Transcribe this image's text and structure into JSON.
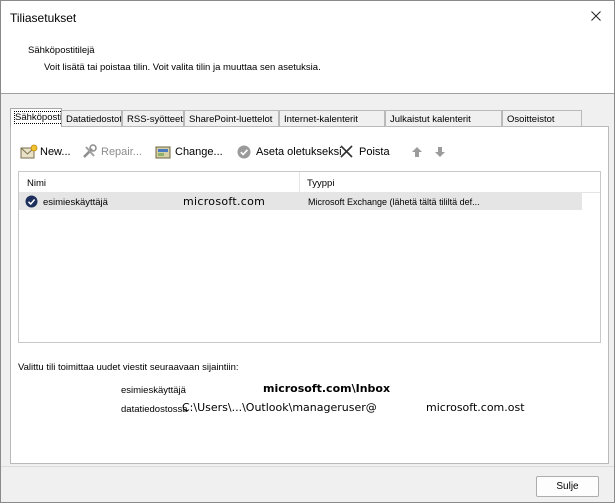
{
  "window": {
    "title": "Tiliasetukset",
    "close_icon": "close-icon"
  },
  "header": {
    "title": "Sähköpostitilejä",
    "description": "Voit lisätä tai poistaa tilin. Voit valita tilin ja muuttaa sen asetuksia."
  },
  "tabs": [
    {
      "label": "Sähköposti",
      "active": true
    },
    {
      "label": "Datatiedostot",
      "active": false
    },
    {
      "label": "RSS-syötteet",
      "active": false
    },
    {
      "label": "SharePoint-luettelot",
      "active": false
    },
    {
      "label": "Internet-kalenterit",
      "active": false
    },
    {
      "label": "Julkaistut kalenterit",
      "active": false
    },
    {
      "label": "Osoitteistot",
      "active": false
    }
  ],
  "toolbar": {
    "new_label": "New...",
    "repair_label": "Repair...",
    "change_label": "Change...",
    "set_default_label": "Aseta oletukseksi",
    "remove_label": "Poista",
    "move_up_icon": "arrow-up-icon",
    "move_down_icon": "arrow-down-icon"
  },
  "accounts_table": {
    "columns": [
      "Nimi",
      "Tyyppi"
    ],
    "rows": [
      {
        "name_user": "esimieskäyttäjä",
        "name_domain": "microsoft.com",
        "type": "Microsoft Exchange (lähetä tältä tililtä def..."
      }
    ]
  },
  "delivery": {
    "label": "Valittu tili toimittaa uudet viestit seuraavaan sijaintiin:",
    "user": "esimieskäyttäjä",
    "inbox": "microsoft.com\\Inbox",
    "file_label": "datatiedostossa",
    "path": "C:\\Users\\...\\Outlook\\manageruser@",
    "path_domain": "microsoft.com.ost"
  },
  "footer": {
    "close_label": "Sulje"
  },
  "colors": {
    "dialog_bg": "#f0f0f0",
    "selected_row": "#e5e5e5",
    "disabled_text": "#8c8c8c"
  }
}
